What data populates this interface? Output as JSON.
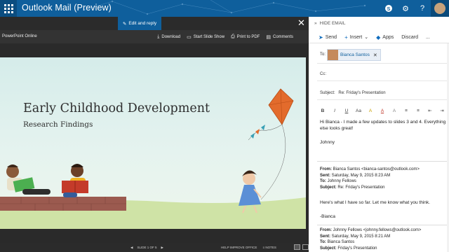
{
  "header": {
    "app_title": "Outlook Mail (Preview)",
    "icons": [
      "waffle-icon",
      "skype-icon",
      "gear-icon",
      "help-icon",
      "avatar"
    ]
  },
  "viewer": {
    "edit_reply_label": "Edit and reply",
    "app_name": "PowerPoint Online",
    "toolbar": {
      "download": "Download",
      "start_slide_show": "Start Slide Show",
      "print_pdf": "Print to PDF",
      "comments": "Comments"
    },
    "slide": {
      "title": "Early Childhood Development",
      "subtitle": "Research Findings"
    },
    "status": {
      "slide_position": "SLIDE 1 OF 5",
      "help_improve": "HELP IMPROVE OFFICE",
      "notes": "NOTES"
    }
  },
  "email": {
    "hide_label": "HIDE EMAIL",
    "actions": {
      "send": "Send",
      "insert": "Insert",
      "apps": "Apps",
      "discard": "Discard",
      "more": "..."
    },
    "to_label": "To:",
    "recipient": "Bianca Santos",
    "cc_label": "Cc:",
    "subject_label": "Subject:",
    "subject": "Re: Friday's Presentation",
    "format_buttons": [
      "B",
      "I",
      "U",
      "Aa",
      "A",
      "A",
      "A",
      "≡",
      "≡",
      "⇤",
      "⇥"
    ],
    "body": {
      "line1": "Hi Bianca - I made a few updates to slides 3 and 4.  Everything",
      "line2": "else looks great!",
      "signature": "Johnny"
    },
    "quoted1": {
      "from_label": "From:",
      "from": "Bianca Santos <bianca-santos@outlook.com>",
      "sent_label": "Sent:",
      "sent": "Saturday, May 9, 2015 8:23 AM",
      "to_label": "To:",
      "to": "Johnny Fellows",
      "subject_label": "Subject:",
      "subject": "Re: Friday's Presentation",
      "body": "Here's what I have so far.  Let me know what you think.",
      "signature": "-Bianca"
    },
    "quoted2": {
      "from_label": "From:",
      "from": "Johnny Fellows <johnny.fellows@outlook.com>",
      "sent_label": "Sent:",
      "sent": "Saturday, May 9, 2015 8:21 AM",
      "to_label": "To:",
      "to": "Bianca Santos",
      "subject_label": "Subject:",
      "subject": "Friday's Presentation"
    }
  },
  "colors": {
    "brand_blue": "#0f5f9c",
    "dark_chrome": "#2b2b2b",
    "kite_orange": "#e36b2c"
  }
}
